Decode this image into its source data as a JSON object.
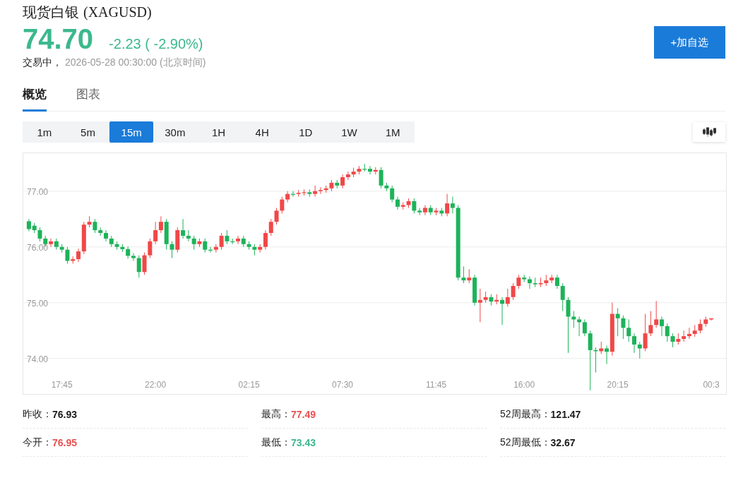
{
  "header": {
    "name": "现货白银",
    "code": "(XAGUSD)",
    "price": "74.70",
    "change": "-2.23 ( -2.90%)",
    "status": "交易中，",
    "timestamp": "2026-05-28 00:30:00",
    "timezone": "(北京时间)"
  },
  "add_button": "+加自选",
  "tabs": [
    {
      "label": "概览",
      "selected": true
    },
    {
      "label": "图表",
      "selected": false
    }
  ],
  "intervals": [
    {
      "label": "1m",
      "selected": false
    },
    {
      "label": "5m",
      "selected": false
    },
    {
      "label": "15m",
      "selected": true
    },
    {
      "label": "30m",
      "selected": false
    },
    {
      "label": "1H",
      "selected": false
    },
    {
      "label": "4H",
      "selected": false
    },
    {
      "label": "1D",
      "selected": false
    },
    {
      "label": "1W",
      "selected": false
    },
    {
      "label": "1M",
      "selected": false
    }
  ],
  "chart_data": {
    "type": "candlestick",
    "grid": true,
    "ylim": [
      73.36,
      77.68
    ],
    "yticks": [
      {
        "value": 74,
        "label": "74.00"
      },
      {
        "value": 75,
        "label": "75.00"
      },
      {
        "value": 76,
        "label": "76.00"
      },
      {
        "value": 77,
        "label": "77.00"
      }
    ],
    "categories": [
      null,
      null,
      null,
      null,
      null,
      null,
      "17:45",
      null,
      null,
      null,
      null,
      null,
      null,
      null,
      null,
      null,
      null,
      null,
      null,
      null,
      null,
      null,
      null,
      "22:00",
      null,
      null,
      null,
      null,
      null,
      null,
      null,
      null,
      null,
      null,
      null,
      null,
      null,
      null,
      null,
      null,
      "02:15",
      null,
      null,
      null,
      null,
      null,
      null,
      null,
      null,
      null,
      null,
      null,
      null,
      null,
      null,
      null,
      null,
      "07:30",
      null,
      null,
      null,
      null,
      null,
      null,
      null,
      null,
      null,
      null,
      null,
      null,
      null,
      null,
      null,
      null,
      "11:45",
      null,
      null,
      null,
      null,
      null,
      null,
      null,
      null,
      null,
      null,
      null,
      null,
      null,
      null,
      null,
      "16:00",
      null,
      null,
      null,
      null,
      null,
      null,
      null,
      null,
      null,
      null,
      null,
      null,
      null,
      null,
      null,
      null,
      "20:15",
      null,
      null,
      null,
      null,
      null,
      null,
      null,
      null,
      null,
      null,
      null,
      null,
      null,
      null,
      null,
      null,
      "00:3"
    ],
    "ohlc": [
      [
        76.46,
        76.5,
        76.28,
        76.32
      ],
      [
        76.38,
        76.43,
        76.25,
        76.3
      ],
      [
        76.3,
        76.35,
        76.1,
        76.15
      ],
      [
        76.15,
        76.2,
        76.0,
        76.05
      ],
      [
        76.05,
        76.15,
        76.0,
        76.1
      ],
      [
        76.1,
        76.15,
        75.95,
        76.0
      ],
      [
        76.0,
        76.05,
        75.9,
        75.95
      ],
      [
        75.95,
        76.0,
        75.7,
        75.75
      ],
      [
        75.75,
        75.83,
        75.7,
        75.78
      ],
      [
        75.78,
        75.97,
        75.73,
        75.92
      ],
      [
        75.92,
        76.45,
        75.87,
        76.4
      ],
      [
        76.4,
        76.55,
        76.35,
        76.45
      ],
      [
        76.45,
        76.5,
        76.25,
        76.3
      ],
      [
        76.3,
        76.35,
        76.2,
        76.25
      ],
      [
        76.25,
        76.3,
        76.1,
        76.15
      ],
      [
        76.15,
        76.2,
        76.0,
        76.05
      ],
      [
        76.05,
        76.1,
        75.95,
        76.0
      ],
      [
        76.0,
        76.05,
        75.91,
        75.96
      ],
      [
        75.96,
        76.01,
        75.79,
        75.84
      ],
      [
        75.84,
        75.89,
        75.75,
        75.8
      ],
      [
        75.8,
        75.85,
        75.45,
        75.55
      ],
      [
        75.55,
        75.9,
        75.5,
        75.85
      ],
      [
        75.85,
        76.15,
        75.8,
        76.1
      ],
      [
        76.1,
        76.45,
        76.05,
        76.3
      ],
      [
        76.3,
        76.55,
        76.25,
        76.45
      ],
      [
        76.45,
        76.5,
        75.95,
        76.05
      ],
      [
        76.05,
        76.1,
        75.8,
        75.95
      ],
      [
        75.95,
        76.35,
        75.9,
        76.3
      ],
      [
        76.3,
        76.5,
        76.15,
        76.2
      ],
      [
        76.2,
        76.3,
        76.1,
        76.15
      ],
      [
        76.15,
        76.2,
        75.95,
        76.05
      ],
      [
        76.05,
        76.15,
        76.0,
        76.1
      ],
      [
        76.1,
        76.15,
        75.9,
        75.95
      ],
      [
        75.95,
        76.0,
        75.9,
        75.95
      ],
      [
        75.95,
        76.05,
        75.9,
        76.0
      ],
      [
        76.0,
        76.25,
        75.95,
        76.2
      ],
      [
        76.2,
        76.3,
        76.05,
        76.1
      ],
      [
        76.1,
        76.15,
        76.05,
        76.1
      ],
      [
        76.1,
        76.2,
        76.05,
        76.15
      ],
      [
        76.15,
        76.2,
        76.0,
        76.05
      ],
      [
        76.05,
        76.1,
        75.95,
        76.0
      ],
      [
        76.0,
        76.05,
        75.85,
        75.95
      ],
      [
        75.95,
        76.05,
        75.9,
        76.0
      ],
      [
        76.0,
        76.3,
        75.95,
        76.25
      ],
      [
        76.25,
        76.5,
        76.2,
        76.45
      ],
      [
        76.45,
        76.7,
        76.4,
        76.65
      ],
      [
        76.65,
        76.9,
        76.6,
        76.85
      ],
      [
        76.85,
        77.0,
        76.8,
        76.95
      ],
      [
        76.95,
        77.0,
        76.9,
        76.95
      ],
      [
        76.95,
        77.02,
        76.9,
        76.97
      ],
      [
        76.97,
        77.03,
        76.92,
        76.98
      ],
      [
        76.98,
        77.03,
        76.9,
        76.95
      ],
      [
        76.95,
        77.1,
        76.9,
        77.0
      ],
      [
        77.0,
        77.07,
        76.95,
        77.02
      ],
      [
        77.02,
        77.1,
        76.97,
        77.05
      ],
      [
        77.05,
        77.2,
        77.0,
        77.15
      ],
      [
        77.15,
        77.2,
        77.05,
        77.1
      ],
      [
        77.1,
        77.3,
        77.05,
        77.25
      ],
      [
        77.25,
        77.35,
        77.2,
        77.3
      ],
      [
        77.3,
        77.42,
        77.25,
        77.35
      ],
      [
        77.35,
        77.45,
        77.3,
        77.4
      ],
      [
        77.4,
        77.49,
        77.35,
        77.4
      ],
      [
        77.4,
        77.45,
        77.3,
        77.35
      ],
      [
        77.35,
        77.43,
        77.3,
        77.38
      ],
      [
        77.38,
        77.43,
        77.05,
        77.1
      ],
      [
        77.1,
        77.15,
        77.0,
        77.05
      ],
      [
        77.05,
        77.1,
        76.8,
        76.85
      ],
      [
        76.85,
        76.9,
        76.67,
        76.72
      ],
      [
        76.72,
        76.8,
        76.67,
        76.75
      ],
      [
        76.75,
        76.87,
        76.7,
        76.82
      ],
      [
        76.82,
        76.87,
        76.6,
        76.65
      ],
      [
        76.65,
        76.7,
        76.57,
        76.62
      ],
      [
        76.62,
        76.75,
        76.57,
        76.7
      ],
      [
        76.7,
        76.75,
        76.57,
        76.62
      ],
      [
        76.62,
        76.7,
        76.57,
        76.65
      ],
      [
        76.65,
        76.7,
        76.55,
        76.6
      ],
      [
        76.6,
        76.95,
        76.55,
        76.78
      ],
      [
        76.78,
        76.9,
        76.6,
        76.7
      ],
      [
        76.7,
        76.75,
        75.4,
        75.45
      ],
      [
        75.45,
        75.65,
        75.35,
        75.4
      ],
      [
        75.4,
        75.6,
        75.35,
        75.45
      ],
      [
        75.45,
        75.5,
        74.95,
        75.0
      ],
      [
        75.0,
        75.25,
        74.65,
        75.05
      ],
      [
        75.05,
        75.2,
        75.0,
        75.1
      ],
      [
        75.1,
        75.15,
        74.95,
        75.02
      ],
      [
        75.02,
        75.15,
        74.97,
        75.05
      ],
      [
        75.05,
        75.1,
        74.6,
        74.98
      ],
      [
        74.98,
        75.25,
        74.93,
        75.1
      ],
      [
        75.1,
        75.35,
        75.05,
        75.3
      ],
      [
        75.3,
        75.5,
        75.25,
        75.45
      ],
      [
        75.45,
        75.5,
        75.37,
        75.42
      ],
      [
        75.42,
        75.47,
        75.25,
        75.35
      ],
      [
        75.35,
        75.45,
        75.28,
        75.33
      ],
      [
        75.33,
        75.45,
        75.28,
        75.35
      ],
      [
        75.35,
        75.5,
        75.3,
        75.4
      ],
      [
        75.4,
        75.5,
        75.35,
        75.45
      ],
      [
        75.45,
        75.5,
        75.25,
        75.3
      ],
      [
        75.3,
        75.35,
        74.85,
        75.05
      ],
      [
        75.05,
        75.1,
        74.1,
        74.75
      ],
      [
        74.75,
        74.85,
        74.55,
        74.7
      ],
      [
        74.7,
        74.75,
        74.4,
        74.65
      ],
      [
        74.65,
        74.7,
        74.4,
        74.45
      ],
      [
        74.45,
        74.5,
        73.43,
        74.15
      ],
      [
        74.15,
        74.2,
        73.75,
        74.13
      ],
      [
        74.13,
        74.3,
        74.08,
        74.18
      ],
      [
        74.18,
        74.23,
        73.9,
        74.12
      ],
      [
        74.12,
        75.0,
        74.05,
        74.8
      ],
      [
        74.8,
        74.9,
        74.4,
        74.72
      ],
      [
        74.72,
        74.77,
        74.35,
        74.55
      ],
      [
        74.55,
        74.7,
        74.3,
        74.4
      ],
      [
        74.4,
        74.45,
        74.1,
        74.25
      ],
      [
        74.25,
        74.3,
        74.0,
        74.18
      ],
      [
        74.18,
        74.8,
        74.13,
        74.45
      ],
      [
        74.45,
        74.85,
        74.4,
        74.6
      ],
      [
        74.6,
        75.03,
        74.55,
        74.7
      ],
      [
        74.7,
        74.75,
        74.4,
        74.58
      ],
      [
        74.58,
        74.63,
        74.3,
        74.4
      ],
      [
        74.4,
        74.45,
        74.2,
        74.3
      ],
      [
        74.3,
        74.45,
        74.25,
        74.35
      ],
      [
        74.35,
        74.5,
        74.3,
        74.4
      ],
      [
        74.4,
        74.55,
        74.35,
        74.44
      ],
      [
        74.44,
        74.6,
        74.39,
        74.5
      ],
      [
        74.5,
        74.7,
        74.45,
        74.62
      ],
      [
        74.62,
        74.75,
        74.57,
        74.7
      ],
      [
        74.7,
        74.72,
        74.68,
        74.72
      ]
    ]
  },
  "stats": [
    {
      "label": "昨收：",
      "value": "76.93",
      "color": "#1a1a1a"
    },
    {
      "label": "最高：",
      "value": "77.49",
      "color": "#e8504f"
    },
    {
      "label": "52周最高：",
      "value": "121.47",
      "color": "#1a1a1a"
    },
    {
      "label": "今开：",
      "value": "76.95",
      "color": "#e8504f"
    },
    {
      "label": "最低：",
      "value": "73.43",
      "color": "#3cb88d"
    },
    {
      "label": "52周最低：",
      "value": "32.67",
      "color": "#1a1a1a"
    }
  ]
}
